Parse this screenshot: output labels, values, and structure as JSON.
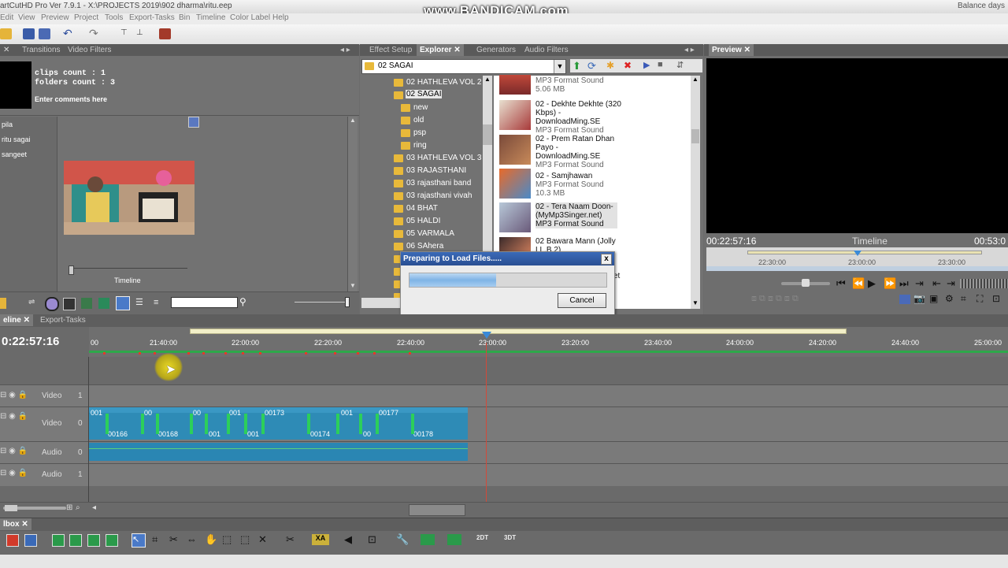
{
  "window": {
    "title": "artCutHD Pro Ver 7.9.1 - X:\\PROJECTS 2019\\902 dharma\\ritu.eep",
    "watermark": "www.BANDICAM.com",
    "balance": "Balance days"
  },
  "menu": [
    "Edit",
    "View",
    "Preview",
    "Project",
    "Tools",
    "Export-Tasks",
    "Bin",
    "Timeline",
    "Color Label",
    "Help"
  ],
  "left_panel": {
    "tabs": [
      "Transitions",
      "Video Filters"
    ],
    "clips_count": "clips count : 1",
    "folders_count": "folders count : 3",
    "comments": "Enter comments here",
    "bins": [
      "pila",
      "ritu sagai",
      "sangeet"
    ],
    "preview_label": "Timeline"
  },
  "explorer": {
    "tabs": [
      "Effect Setup",
      "Explorer",
      "Generators",
      "Audio Filters"
    ],
    "path": "02 SAGAI",
    "tree": [
      {
        "label": "02 HATHLEVA VOL 2",
        "indent": 0
      },
      {
        "label": "02 SAGAI",
        "indent": 0,
        "selected": true
      },
      {
        "label": "new",
        "indent": 1
      },
      {
        "label": "old",
        "indent": 1
      },
      {
        "label": "psp",
        "indent": 1
      },
      {
        "label": "ring",
        "indent": 1
      },
      {
        "label": "03 HATHLEVA VOL 3",
        "indent": 0
      },
      {
        "label": "03 RAJASTHANI",
        "indent": 0
      },
      {
        "label": "03 rajasthani band",
        "indent": 0
      },
      {
        "label": "03 rajasthani vivah",
        "indent": 0
      },
      {
        "label": "04 BHAT",
        "indent": 0
      },
      {
        "label": "05 HALDI",
        "indent": 0
      },
      {
        "label": "05 VARMALA",
        "indent": 0
      },
      {
        "label": "06 SAhera",
        "indent": 0
      }
    ],
    "files": [
      {
        "name": "",
        "type": "MP3 Format Sound",
        "size": "5.06 MB"
      },
      {
        "name": "02 - Dekhte Dekhte (320 Kbps) - DownloadMing.SE",
        "type": "MP3 Format Sound",
        "size": ""
      },
      {
        "name": "02 - Prem Ratan Dhan Payo - DownloadMing.SE",
        "type": "MP3 Format Sound",
        "size": ""
      },
      {
        "name": "02 - Samjhawan",
        "type": "MP3 Format Sound",
        "size": "10.3 MB"
      },
      {
        "name": "02 - Tera Naam Doon-(MyMp3Singer.net)",
        "type": "MP3 Format Sound",
        "size": ""
      },
      {
        "name": "02 Bawara Mann (Jolly LL.B 2)",
        "type": "",
        "size": ""
      }
    ],
    "partial_text": "et"
  },
  "preview": {
    "tab": "Preview",
    "timecode": "00:22:57:16",
    "label": "Timeline",
    "timecode_right": "00:53:0",
    "ruler": [
      "22:30:00",
      "23:00:00",
      "23:30:00"
    ]
  },
  "dialog": {
    "title": "Preparing to Load Files.....",
    "progress": 0.44,
    "cancel_label": "Cancel",
    "close_label": "x"
  },
  "timeline": {
    "tabs": [
      "eline",
      "Export-Tasks"
    ],
    "timecode": "0:22:57:16",
    "ruler": [
      "00",
      "21:40:00",
      "22:00:00",
      "22:20:00",
      "22:40:00",
      "23:00:00",
      "23:20:00",
      "23:40:00",
      "24:00:00",
      "24:20:00",
      "24:40:00",
      "25:00:00"
    ],
    "tracks": [
      {
        "name": "Video",
        "index": "1"
      },
      {
        "name": "Video",
        "index": "0"
      },
      {
        "name": "Audio",
        "index": "0"
      },
      {
        "name": "Audio",
        "index": "1"
      }
    ],
    "clip_labels_top": [
      "001",
      "00",
      "00",
      "001",
      "00173",
      "001",
      "00177"
    ],
    "clip_labels_bottom": [
      "00166",
      "00168",
      "001",
      "001",
      "00174",
      "00",
      "00178"
    ]
  },
  "toolbox": {
    "tab": "lbox",
    "labels": [
      "2DT",
      "3DT"
    ]
  },
  "colors": {
    "panel": "#727272",
    "clip": "#2e8bb6",
    "audio_clip": "#2a86b3",
    "selection": "#3a6ab8",
    "playhead": "#d24a3a"
  }
}
